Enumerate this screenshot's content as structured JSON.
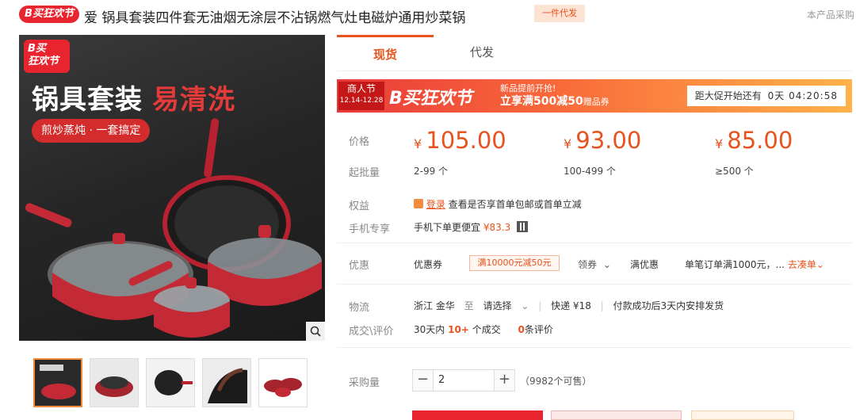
{
  "header": {
    "brand_badge": "B买狂欢节",
    "title": "爱 锅具套装四件套无油烟无涂层不沾锅燃气灶电磁炉通用炒菜锅",
    "dropship_tag": "一件代发",
    "right_text": "本产品采购"
  },
  "gallery": {
    "badge_line1": "B买",
    "badge_line2": "狂欢节",
    "headline_white": "锅具套装",
    "headline_red": "易清洗",
    "slogan": "煎炒蒸炖 · 一套搞定",
    "zoom_icon": "magnifier-icon",
    "thumbnails": [
      "thumb-1",
      "thumb-2",
      "thumb-3",
      "thumb-4",
      "thumb-5"
    ]
  },
  "tabs": [
    {
      "label": "现货",
      "active": true
    },
    {
      "label": "代发",
      "active": false
    }
  ],
  "banner": {
    "box_main": "商人节",
    "box_date": "12.14-12.28",
    "festival": "B买狂欢节",
    "promo_line1": "新品提前开抢!",
    "promo_line2": "立享满500减50",
    "promo_line2_tail": "赠品券",
    "countdown_label": "距大促开始还有",
    "countdown_value": "0天 04:20:58"
  },
  "pricing": {
    "price_label": "价格",
    "moq_label": "起批量",
    "tiers": [
      {
        "currency": "¥",
        "price": "105.00",
        "range": "2-99 个"
      },
      {
        "currency": "¥",
        "price": "93.00",
        "range": "100-499 个"
      },
      {
        "currency": "¥",
        "price": "85.00",
        "range": "≥500 个"
      }
    ]
  },
  "benefits": {
    "label": "权益",
    "login_link": "登录",
    "text": "查看是否享首单包邮或首单立减",
    "mobile_label": "手机专享",
    "mobile_text": "手机下单更便宜",
    "mobile_price": "¥83.3"
  },
  "discount": {
    "label": "优惠",
    "coupon_label": "优惠券",
    "coupon_value": "满10000元减50元",
    "claim": "领券",
    "full_discount_label": "满优惠",
    "full_discount_text": "单笔订单满1000元，...",
    "go_link": "去凑单"
  },
  "logistics": {
    "label": "物流",
    "origin": "浙江 金华",
    "to": "至",
    "dest": "请选择",
    "express": "快递 ¥18",
    "ship_note": "付款成功后3天内安排发货"
  },
  "reviews": {
    "label": "成交\\评价",
    "deals_prefix": "30天内",
    "deals_count": "10+",
    "deals_suffix": "个成交",
    "review_count": "0",
    "review_suffix": "条评价"
  },
  "purchase": {
    "label": "采购量",
    "quantity": "2",
    "minus": "−",
    "plus": "+",
    "stock": "（9982个可售）"
  }
}
